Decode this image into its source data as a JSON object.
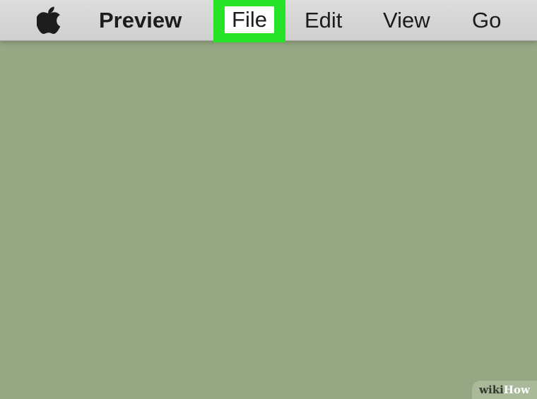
{
  "menubar": {
    "apple_icon": "apple-logo-icon",
    "app_name": "Preview",
    "items": [
      {
        "label": "File",
        "highlighted": true
      },
      {
        "label": "Edit"
      },
      {
        "label": "View"
      },
      {
        "label": "Go"
      }
    ],
    "highlight_color": "#27e327"
  },
  "desktop": {
    "background_color": "#96a783"
  },
  "watermark": {
    "wiki": "wiki",
    "how": "How"
  }
}
